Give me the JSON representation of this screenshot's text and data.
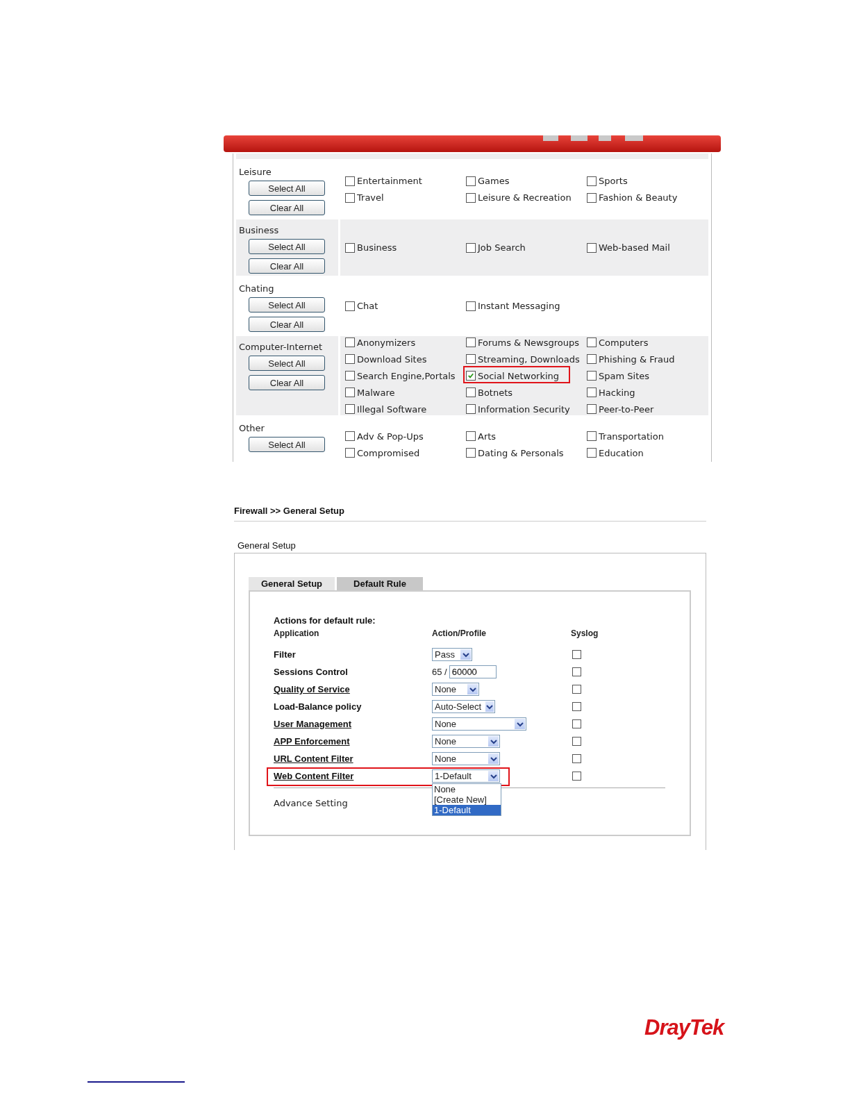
{
  "category_panel": {
    "groups": [
      {
        "name": "Leisure",
        "buttons": [
          "Select All",
          "Clear All"
        ],
        "items": [
          {
            "label": "Entertainment",
            "checked": false,
            "highlighted": false
          },
          {
            "label": "Games",
            "checked": false,
            "highlighted": false
          },
          {
            "label": "Sports",
            "checked": false,
            "highlighted": false
          },
          {
            "label": "Travel",
            "checked": false,
            "highlighted": false
          },
          {
            "label": "Leisure & Recreation",
            "checked": false,
            "highlighted": false
          },
          {
            "label": "Fashion & Beauty",
            "checked": false,
            "highlighted": false
          }
        ]
      },
      {
        "name": "Business",
        "buttons": [
          "Select All",
          "Clear All"
        ],
        "items": [
          {
            "label": "Business",
            "checked": false,
            "highlighted": false
          },
          {
            "label": "Job Search",
            "checked": false,
            "highlighted": false
          },
          {
            "label": "Web-based Mail",
            "checked": false,
            "highlighted": false
          }
        ]
      },
      {
        "name": "Chating",
        "buttons": [
          "Select All",
          "Clear All"
        ],
        "items": [
          {
            "label": "Chat",
            "checked": false,
            "highlighted": false
          },
          {
            "label": "Instant Messaging",
            "checked": false,
            "highlighted": false
          }
        ]
      },
      {
        "name": "Computer-Internet",
        "buttons": [
          "Select All",
          "Clear All"
        ],
        "items": [
          {
            "label": "Anonymizers",
            "checked": false,
            "highlighted": false
          },
          {
            "label": "Forums & Newsgroups",
            "checked": false,
            "highlighted": false
          },
          {
            "label": "Computers",
            "checked": false,
            "highlighted": false
          },
          {
            "label": "Download Sites",
            "checked": false,
            "highlighted": false
          },
          {
            "label": "Streaming, Downloads",
            "checked": false,
            "highlighted": false
          },
          {
            "label": "Phishing & Fraud",
            "checked": false,
            "highlighted": false
          },
          {
            "label": "Search Engine,Portals",
            "checked": false,
            "highlighted": false
          },
          {
            "label": "Social Networking",
            "checked": true,
            "highlighted": true
          },
          {
            "label": "Spam Sites",
            "checked": false,
            "highlighted": false
          },
          {
            "label": "Malware",
            "checked": false,
            "highlighted": false
          },
          {
            "label": "Botnets",
            "checked": false,
            "highlighted": false
          },
          {
            "label": "Hacking",
            "checked": false,
            "highlighted": false
          },
          {
            "label": "Illegal Software",
            "checked": false,
            "highlighted": false
          },
          {
            "label": "Information Security",
            "checked": false,
            "highlighted": false
          },
          {
            "label": "Peer-to-Peer",
            "checked": false,
            "highlighted": false
          }
        ]
      },
      {
        "name": "Other",
        "buttons": [
          "Select All"
        ],
        "items": [
          {
            "label": "Adv & Pop-Ups",
            "checked": false,
            "highlighted": false
          },
          {
            "label": "Arts",
            "checked": false,
            "highlighted": false
          },
          {
            "label": "Transportation",
            "checked": false,
            "highlighted": false
          },
          {
            "label": "Compromised",
            "checked": false,
            "highlighted": false
          },
          {
            "label": "Dating & Personals",
            "checked": false,
            "highlighted": false
          },
          {
            "label": "Education",
            "checked": false,
            "highlighted": false
          }
        ]
      }
    ]
  },
  "firewall": {
    "breadcrumb": "Firewall >> General Setup",
    "section_title": "General Setup",
    "tabs": [
      {
        "label": "General Setup",
        "selected": false
      },
      {
        "label": "Default Rule",
        "selected": true
      }
    ],
    "heading": "Actions for default rule:",
    "columns": [
      "Application",
      "Action/Profile",
      "Syslog"
    ],
    "rows": [
      {
        "label": "Filter",
        "link": false,
        "kind": "select",
        "value": "Pass",
        "syslog": false,
        "highlighted": false
      },
      {
        "label": "Sessions Control",
        "link": false,
        "kind": "sessions",
        "count": "65 /",
        "value": "60000",
        "syslog": false,
        "highlighted": false
      },
      {
        "label": "Quality of Service",
        "link": true,
        "kind": "select",
        "value": "None",
        "syslog": false,
        "highlighted": false
      },
      {
        "label": "Load-Balance policy",
        "link": false,
        "kind": "select",
        "value": "Auto-Select",
        "syslog": false,
        "highlighted": false
      },
      {
        "label": "User Management",
        "link": true,
        "kind": "select",
        "value": "None",
        "syslog": false,
        "highlighted": false
      },
      {
        "label": "APP Enforcement",
        "link": true,
        "kind": "select",
        "value": "None",
        "syslog": false,
        "highlighted": false
      },
      {
        "label": "URL Content Filter",
        "link": true,
        "kind": "select",
        "value": "None",
        "syslog": false,
        "highlighted": false
      },
      {
        "label": "Web Content Filter",
        "link": true,
        "kind": "select",
        "value": "1-Default",
        "syslog": false,
        "highlighted": true,
        "options": [
          {
            "label": "None",
            "selected": false
          },
          {
            "label": "[Create New]",
            "selected": false
          },
          {
            "label": "1-Default",
            "selected": true
          }
        ]
      }
    ],
    "advance_setting": "Advance Setting"
  },
  "logo": "DrayTek"
}
